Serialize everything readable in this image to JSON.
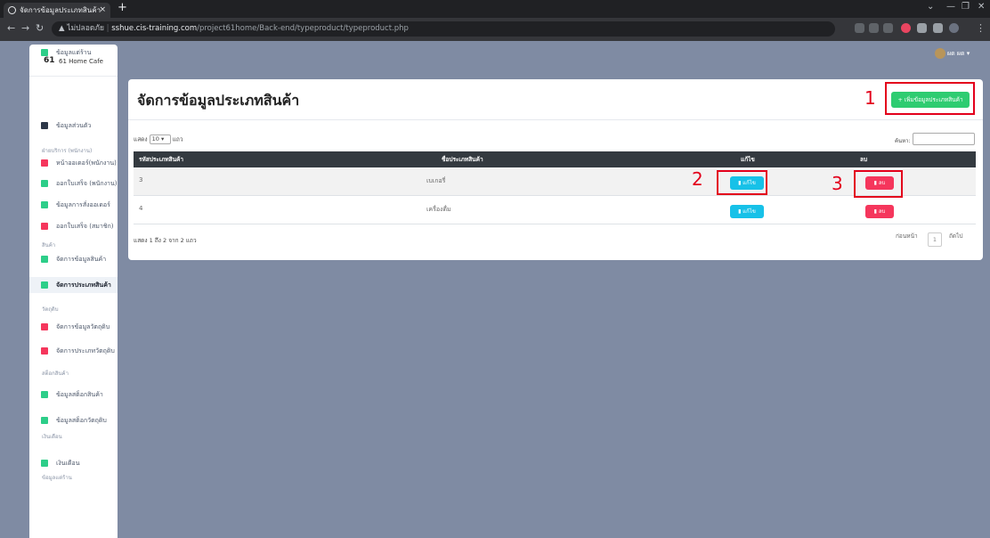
{
  "browser": {
    "tab_title": "จัดการข้อมูลประเภทสินค้า",
    "tab_close": "×",
    "new_tab": "+",
    "url_warning": "▲ ไม่ปลอดภัย",
    "url_domain": "sshue.cis-training.com",
    "url_path": "/project61home/Back-end/typeproduct/typeproduct.php"
  },
  "brand": {
    "logo": "61",
    "name": "61 Home Cafe"
  },
  "sidebar": {
    "items": [
      {
        "label": "ข้อมูลส่วนตัว",
        "color": "#2d3748"
      },
      {
        "group": "ฝ่ายบริการ (พนักงาน)"
      },
      {
        "label": "หน้าออเดอร์(พนักงาน)",
        "color": "#f5365c"
      },
      {
        "label": "ออกใบเสร็จ (พนักงาน)",
        "color": "#2dce89"
      },
      {
        "label": "ข้อมูลการสั่งออเดอร์",
        "color": "#2dce89"
      },
      {
        "label": "ออกใบเสร็จ (สมาชิก)",
        "color": "#f5365c"
      },
      {
        "group": "สินค้า"
      },
      {
        "label": "จัดการข้อมูลสินค้า",
        "color": "#2dce89"
      },
      {
        "label": "จัดการประเภทสินค้า",
        "color": "#2dce89"
      },
      {
        "group": "วัตถุดิบ"
      },
      {
        "label": "จัดการข้อมูลวัตถุดิบ",
        "color": "#f5365c"
      },
      {
        "label": "จัดการประเภทวัตถุดิบ",
        "color": "#f5365c"
      },
      {
        "group": "สต็อกสินค้า"
      },
      {
        "label": "ข้อมูลสต็อกสินค้า",
        "color": "#2dce89"
      },
      {
        "label": "ข้อมูลสต็อกวัตถุดิบ",
        "color": "#2dce89"
      },
      {
        "group": "เงินเดือน"
      },
      {
        "label": "เงินเดือน",
        "color": "#2dce89"
      },
      {
        "group": "ข้อมูลแต่ร้าน"
      },
      {
        "label": "ข้อมูลแต่ร้าน",
        "color": "#2dce89"
      }
    ]
  },
  "user": {
    "name": "ผด ผด ▾"
  },
  "page": {
    "title": "จัดการข้อมูลประเภทสินค้า",
    "add_button": "+ เพิ่มข้อมูลประเภทสินค้า"
  },
  "annotations": [
    "1",
    "2",
    "3"
  ],
  "table": {
    "length_prefix": "แสดง",
    "length_value": "10 ▾",
    "length_suffix": "แถว",
    "search_label": "ค้นหา:",
    "headers": [
      "รหัสประเภทสินค้า",
      "ชื่อประเภทสินค้า",
      "แก้ไข",
      "ลบ"
    ],
    "rows": [
      {
        "id": "3",
        "name": "เบเกอรี่"
      },
      {
        "id": "4",
        "name": "เครื่องดื่ม"
      }
    ],
    "edit_label": "▮ แก้ไข",
    "delete_label": "▮ ลบ",
    "info": "แสดง 1 ถึง 2 จาก 2 แถว",
    "prev": "ก่อนหน้า",
    "page": "1",
    "next": "ถัดไป"
  },
  "colors": {
    "accent_green": "#2ecc71",
    "edit": "#17c1e8",
    "delete": "#f5365c",
    "highlight": "#e3001b"
  }
}
